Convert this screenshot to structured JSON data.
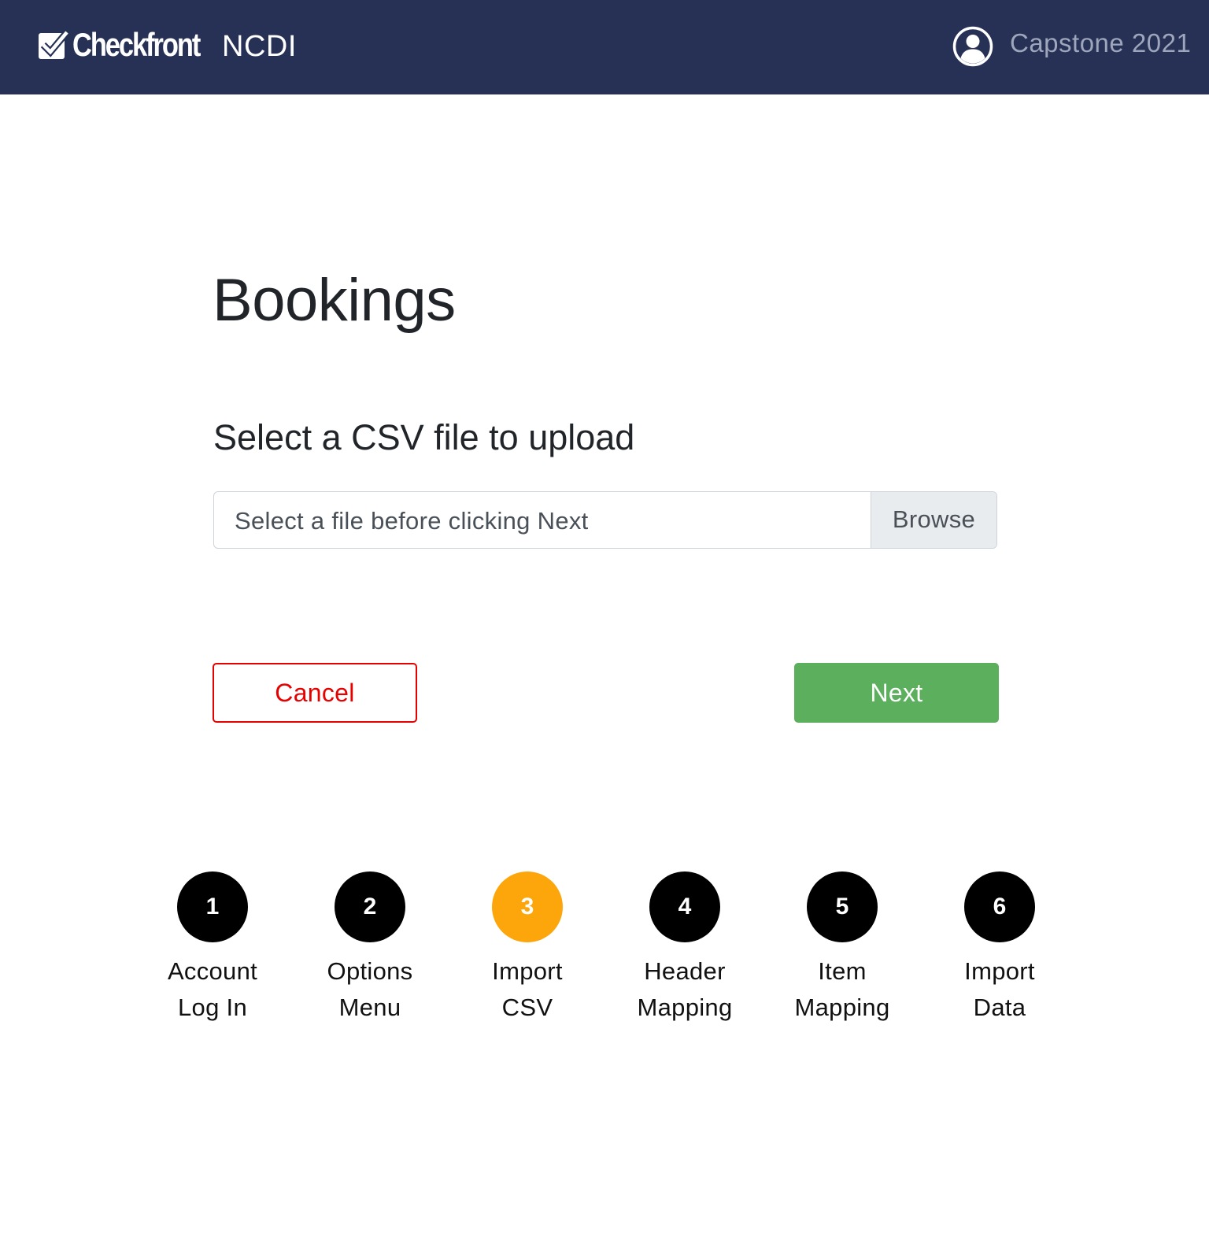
{
  "header": {
    "brand": "Checkfront",
    "app_name": "NCDI",
    "user_name": "Capstone 2021",
    "colors": {
      "background": "#273155",
      "user_text": "#9ea6bc"
    },
    "icons": {
      "logo": "checkbox-check-icon",
      "user": "user-circle-icon"
    }
  },
  "page": {
    "title": "Bookings",
    "section_title": "Select a CSV file to upload"
  },
  "file_input": {
    "placeholder": "Select a file before clicking Next",
    "browse_label": "Browse"
  },
  "actions": {
    "cancel_label": "Cancel",
    "next_label": "Next",
    "colors": {
      "cancel": "#e60000",
      "next": "#5caf5c"
    }
  },
  "steps": {
    "active_step": 3,
    "active_color": "#fca60b",
    "items": [
      {
        "number": "1",
        "line1": "Account",
        "line2": "Log In"
      },
      {
        "number": "2",
        "line1": "Options",
        "line2": "Menu"
      },
      {
        "number": "3",
        "line1": "Import",
        "line2": "CSV"
      },
      {
        "number": "4",
        "line1": "Header",
        "line2": "Mapping"
      },
      {
        "number": "5",
        "line1": "Item",
        "line2": "Mapping"
      },
      {
        "number": "6",
        "line1": "Import",
        "line2": "Data"
      }
    ]
  }
}
